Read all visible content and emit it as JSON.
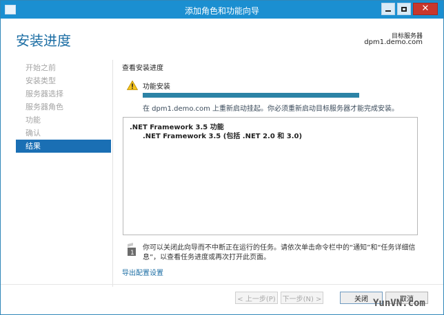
{
  "window": {
    "title": "添加角色和功能向导"
  },
  "page": {
    "title": "安装进度",
    "destination_label": "目标服务器",
    "destination_server": "dpm1.demo.com"
  },
  "nav": {
    "items": [
      {
        "label": "开始之前",
        "active": false
      },
      {
        "label": "安装类型",
        "active": false
      },
      {
        "label": "服务器选择",
        "active": false
      },
      {
        "label": "服务器角色",
        "active": false
      },
      {
        "label": "功能",
        "active": false
      },
      {
        "label": "确认",
        "active": false
      },
      {
        "label": "结果",
        "active": true
      }
    ]
  },
  "main": {
    "section_heading": "查看安装进度",
    "status_icon": "warning-icon",
    "feature_install_label": "功能安装",
    "progress_fraction": 1.0,
    "restart_message": "在 dpm1.demo.com 上重新启动挂起。你必须重新启动目标服务器才能完成安装。",
    "results": [
      {
        "text": ".NET Framework 3.5 功能",
        "level": 0
      },
      {
        "text": ".NET Framework 3.5 (包括 .NET 2.0 和 3.0)",
        "level": 1
      }
    ],
    "note_text": "你可以关闭此向导而不中断正在运行的任务。请依次单击命令栏中的“通知”和“任务详细信息”，以查看任务进度或再次打开此页面。",
    "export_link": "导出配置设置"
  },
  "footer": {
    "prev_label": "< 上一步(P)",
    "next_label": "下一步(N) >",
    "close_label": "关闭",
    "cancel_label": "取消"
  },
  "watermark": "YunVN.com",
  "colors": {
    "title_bar": "#1b8fd1",
    "accent": "#1a6fb4",
    "progress": "#2c83a6",
    "close_button": "#c8372d"
  }
}
